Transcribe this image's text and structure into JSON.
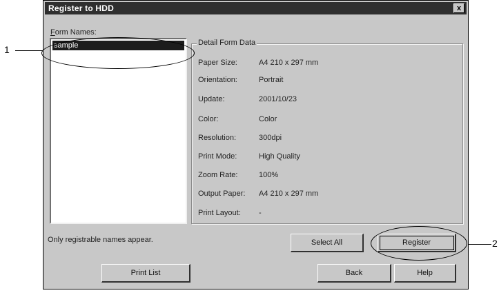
{
  "window": {
    "title": "Register to HDD",
    "close_label": "x"
  },
  "form_names": {
    "label": "Form Names:",
    "items": [
      "sample"
    ],
    "selected": "sample"
  },
  "detail": {
    "caption": "Detail Form Data",
    "rows": [
      {
        "key": "Paper Size:",
        "value": "A4 210 x 297 mm"
      },
      {
        "key": "Orientation:",
        "value": "Portrait"
      },
      {
        "key": "Update:",
        "value": "2001/10/23"
      },
      {
        "key": "Color:",
        "value": "Color"
      },
      {
        "key": "Resolution:",
        "value": "300dpi"
      },
      {
        "key": "Print Mode:",
        "value": "High Quality"
      },
      {
        "key": "Zoom Rate:",
        "value": "100%"
      },
      {
        "key": "Output Paper:",
        "value": "A4 210 x 297 mm"
      },
      {
        "key": "Print Layout:",
        "value": "-"
      }
    ]
  },
  "hint": "Only registrable names appear.",
  "buttons": {
    "print_list": "Print List",
    "select_all": "Select All",
    "register": "Register",
    "back": "Back",
    "help": "Help"
  },
  "callouts": {
    "one": "1",
    "two": "2"
  }
}
